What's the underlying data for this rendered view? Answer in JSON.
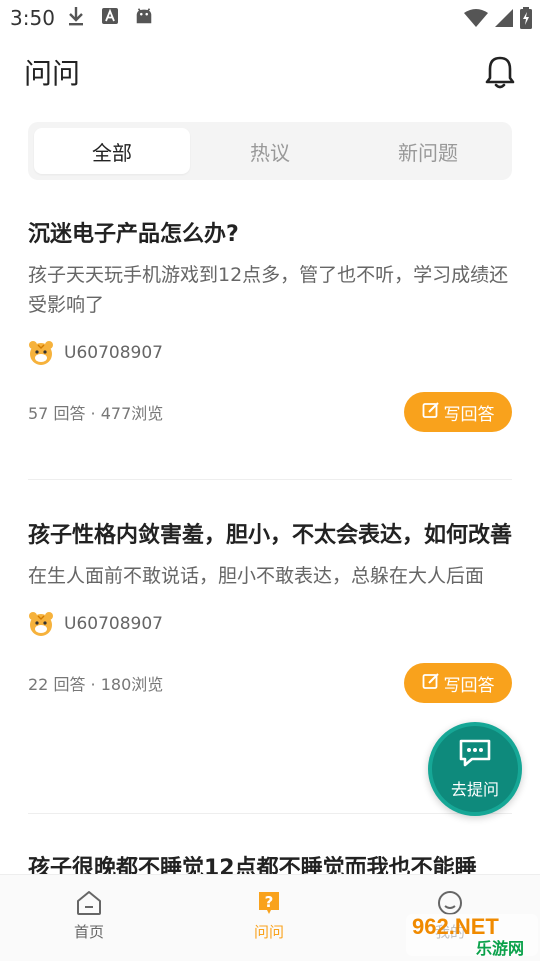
{
  "status_bar": {
    "time": "3:50"
  },
  "header": {
    "title": "问问"
  },
  "tabs": [
    {
      "label": "全部",
      "active": true
    },
    {
      "label": "热议",
      "active": false
    },
    {
      "label": "新问题",
      "active": false
    }
  ],
  "questions": [
    {
      "title": "沉迷电子产品怎么办?",
      "desc": "孩子天天玩手机游戏到12点多，管了也不听，学习成绩还受影响了",
      "author": "U60708907",
      "stats": "57 回答 · 477浏览",
      "answer_label": "写回答"
    },
    {
      "title": "孩子性格内敛害羞，胆小，不太会表达，如何改善",
      "desc": "在生人面前不敢说话，胆小不敢表达，总躲在大人后面",
      "author": "U60708907",
      "stats": "22 回答 · 180浏览",
      "answer_label": "写回答"
    },
    {
      "title": "孩子很晚都不睡觉12点都不睡觉而我也不能睡"
    }
  ],
  "fab": {
    "label": "去提问"
  },
  "bottom_nav": [
    {
      "label": "首页",
      "active": false
    },
    {
      "label": "问问",
      "active": true
    },
    {
      "label": "我的",
      "active": false
    }
  ],
  "watermark": {
    "text1": "962.NET",
    "text2": "乐游网"
  },
  "colors": {
    "accent": "#f9a21c",
    "fab": "#0e8a7c",
    "active_nav": "#f9a21c"
  }
}
